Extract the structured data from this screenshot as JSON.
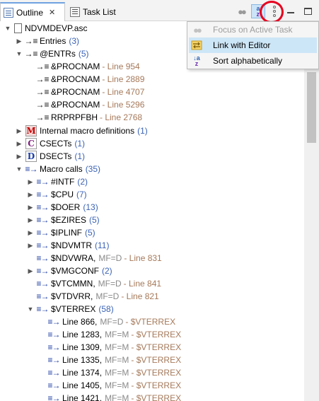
{
  "tabs": [
    {
      "label": "Outline",
      "active": true
    },
    {
      "label": "Task List",
      "active": false
    }
  ],
  "tab_close_glyph": "✕",
  "toolbar": {
    "icons": [
      "focus-dots-icon",
      "sort-alpha-icon",
      "view-menu-icon",
      "minimize-icon",
      "maximize-icon"
    ]
  },
  "menu": {
    "items": [
      {
        "label": "Focus on Active Task",
        "enabled": false,
        "icon": "focus-dots-icon"
      },
      {
        "label": "Link with Editor",
        "enabled": true,
        "hover": true,
        "icon": "link-editor-icon"
      },
      {
        "label": "Sort alphabetically",
        "enabled": true,
        "icon": "sort-alpha-icon"
      }
    ]
  },
  "tree": {
    "root": "NDVMDEVP.asc",
    "entries": {
      "label": "Entries",
      "count": "(3)"
    },
    "entrs": {
      "label": "@ENTRs",
      "count": "(5)",
      "children": [
        {
          "label": "&PROCNAM",
          "line": "- Line 954"
        },
        {
          "label": "&PROCNAM",
          "line": "- Line 2889"
        },
        {
          "label": "&PROCNAM",
          "line": "- Line 4707"
        },
        {
          "label": "&PROCNAM",
          "line": "- Line 5296"
        },
        {
          "label": "RRPRPFBH",
          "line": "- Line 2768"
        }
      ]
    },
    "internal_macros": {
      "label": "Internal macro definitions",
      "count": "(1)"
    },
    "csects": {
      "label": "CSECTs",
      "count": "(1)"
    },
    "dsects": {
      "label": "DSECTs",
      "count": "(1)"
    },
    "macro_calls": {
      "label": "Macro calls",
      "count": "(35)",
      "children": [
        {
          "label": "#INTF",
          "count": "(2)"
        },
        {
          "label": "$CPU",
          "count": "(7)"
        },
        {
          "label": "$DOER",
          "count": "(13)"
        },
        {
          "label": "$EZIRES",
          "count": "(5)"
        },
        {
          "label": "$IPLINF",
          "count": "(5)"
        },
        {
          "label": "$NDVMTR",
          "count": "(11)"
        },
        {
          "label": "$NDVWRA,",
          "meta": "MF=D",
          "line": "- Line 831"
        },
        {
          "label": "$VMGCONF",
          "count": "(2)"
        },
        {
          "label": "$VTCMMN,",
          "meta": "MF=D",
          "line": "- Line 841"
        },
        {
          "label": "$VTDVRR,",
          "meta": "MF=D",
          "line": "- Line 821"
        },
        {
          "label": "$VTERREX",
          "count": "(58)"
        }
      ]
    },
    "vterrex_children": [
      {
        "label": "Line 866,",
        "meta": "MF=D",
        "tag": "- $VTERREX"
      },
      {
        "label": "Line 1283,",
        "meta": "MF=M",
        "tag": "- $VTERREX"
      },
      {
        "label": "Line 1309,",
        "meta": "MF=M",
        "tag": "- $VTERREX"
      },
      {
        "label": "Line 1335,",
        "meta": "MF=M",
        "tag": "- $VTERREX"
      },
      {
        "label": "Line 1374,",
        "meta": "MF=M",
        "tag": "- $VTERREX"
      },
      {
        "label": "Line 1405,",
        "meta": "MF=M",
        "tag": "- $VTERREX"
      },
      {
        "label": "Line 1421,",
        "meta": "MF=M",
        "tag": "- $VTERREX"
      }
    ]
  }
}
